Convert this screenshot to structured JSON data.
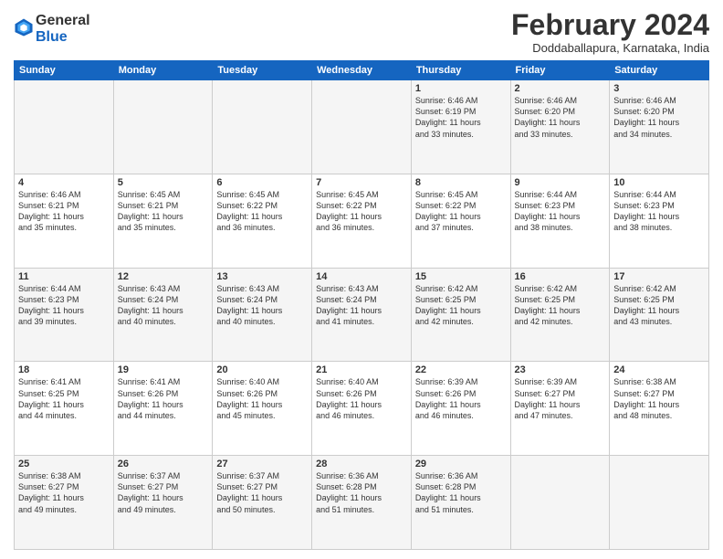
{
  "header": {
    "logo_general": "General",
    "logo_blue": "Blue",
    "title": "February 2024",
    "location": "Doddaballapura, Karnataka, India"
  },
  "days_of_week": [
    "Sunday",
    "Monday",
    "Tuesday",
    "Wednesday",
    "Thursday",
    "Friday",
    "Saturday"
  ],
  "weeks": [
    [
      {
        "day": "",
        "info": ""
      },
      {
        "day": "",
        "info": ""
      },
      {
        "day": "",
        "info": ""
      },
      {
        "day": "",
        "info": ""
      },
      {
        "day": "1",
        "info": "Sunrise: 6:46 AM\nSunset: 6:19 PM\nDaylight: 11 hours\nand 33 minutes."
      },
      {
        "day": "2",
        "info": "Sunrise: 6:46 AM\nSunset: 6:20 PM\nDaylight: 11 hours\nand 33 minutes."
      },
      {
        "day": "3",
        "info": "Sunrise: 6:46 AM\nSunset: 6:20 PM\nDaylight: 11 hours\nand 34 minutes."
      }
    ],
    [
      {
        "day": "4",
        "info": "Sunrise: 6:46 AM\nSunset: 6:21 PM\nDaylight: 11 hours\nand 35 minutes."
      },
      {
        "day": "5",
        "info": "Sunrise: 6:45 AM\nSunset: 6:21 PM\nDaylight: 11 hours\nand 35 minutes."
      },
      {
        "day": "6",
        "info": "Sunrise: 6:45 AM\nSunset: 6:22 PM\nDaylight: 11 hours\nand 36 minutes."
      },
      {
        "day": "7",
        "info": "Sunrise: 6:45 AM\nSunset: 6:22 PM\nDaylight: 11 hours\nand 36 minutes."
      },
      {
        "day": "8",
        "info": "Sunrise: 6:45 AM\nSunset: 6:22 PM\nDaylight: 11 hours\nand 37 minutes."
      },
      {
        "day": "9",
        "info": "Sunrise: 6:44 AM\nSunset: 6:23 PM\nDaylight: 11 hours\nand 38 minutes."
      },
      {
        "day": "10",
        "info": "Sunrise: 6:44 AM\nSunset: 6:23 PM\nDaylight: 11 hours\nand 38 minutes."
      }
    ],
    [
      {
        "day": "11",
        "info": "Sunrise: 6:44 AM\nSunset: 6:23 PM\nDaylight: 11 hours\nand 39 minutes."
      },
      {
        "day": "12",
        "info": "Sunrise: 6:43 AM\nSunset: 6:24 PM\nDaylight: 11 hours\nand 40 minutes."
      },
      {
        "day": "13",
        "info": "Sunrise: 6:43 AM\nSunset: 6:24 PM\nDaylight: 11 hours\nand 40 minutes."
      },
      {
        "day": "14",
        "info": "Sunrise: 6:43 AM\nSunset: 6:24 PM\nDaylight: 11 hours\nand 41 minutes."
      },
      {
        "day": "15",
        "info": "Sunrise: 6:42 AM\nSunset: 6:25 PM\nDaylight: 11 hours\nand 42 minutes."
      },
      {
        "day": "16",
        "info": "Sunrise: 6:42 AM\nSunset: 6:25 PM\nDaylight: 11 hours\nand 42 minutes."
      },
      {
        "day": "17",
        "info": "Sunrise: 6:42 AM\nSunset: 6:25 PM\nDaylight: 11 hours\nand 43 minutes."
      }
    ],
    [
      {
        "day": "18",
        "info": "Sunrise: 6:41 AM\nSunset: 6:25 PM\nDaylight: 11 hours\nand 44 minutes."
      },
      {
        "day": "19",
        "info": "Sunrise: 6:41 AM\nSunset: 6:26 PM\nDaylight: 11 hours\nand 44 minutes."
      },
      {
        "day": "20",
        "info": "Sunrise: 6:40 AM\nSunset: 6:26 PM\nDaylight: 11 hours\nand 45 minutes."
      },
      {
        "day": "21",
        "info": "Sunrise: 6:40 AM\nSunset: 6:26 PM\nDaylight: 11 hours\nand 46 minutes."
      },
      {
        "day": "22",
        "info": "Sunrise: 6:39 AM\nSunset: 6:26 PM\nDaylight: 11 hours\nand 46 minutes."
      },
      {
        "day": "23",
        "info": "Sunrise: 6:39 AM\nSunset: 6:27 PM\nDaylight: 11 hours\nand 47 minutes."
      },
      {
        "day": "24",
        "info": "Sunrise: 6:38 AM\nSunset: 6:27 PM\nDaylight: 11 hours\nand 48 minutes."
      }
    ],
    [
      {
        "day": "25",
        "info": "Sunrise: 6:38 AM\nSunset: 6:27 PM\nDaylight: 11 hours\nand 49 minutes."
      },
      {
        "day": "26",
        "info": "Sunrise: 6:37 AM\nSunset: 6:27 PM\nDaylight: 11 hours\nand 49 minutes."
      },
      {
        "day": "27",
        "info": "Sunrise: 6:37 AM\nSunset: 6:27 PM\nDaylight: 11 hours\nand 50 minutes."
      },
      {
        "day": "28",
        "info": "Sunrise: 6:36 AM\nSunset: 6:28 PM\nDaylight: 11 hours\nand 51 minutes."
      },
      {
        "day": "29",
        "info": "Sunrise: 6:36 AM\nSunset: 6:28 PM\nDaylight: 11 hours\nand 51 minutes."
      },
      {
        "day": "",
        "info": ""
      },
      {
        "day": "",
        "info": ""
      }
    ]
  ]
}
